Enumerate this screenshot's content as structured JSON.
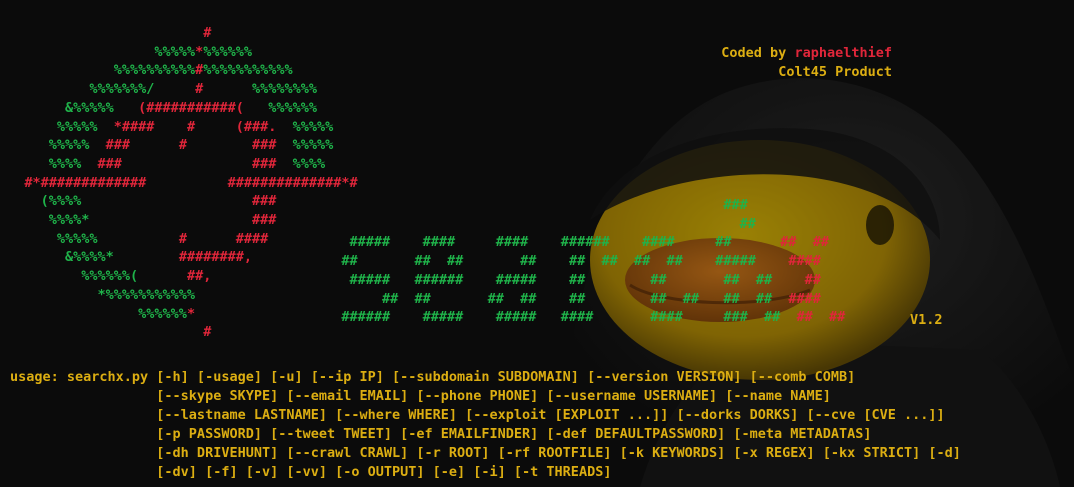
{
  "colors": {
    "background": "#0c0c0c",
    "green": "#1fb34a",
    "red": "#e0263a",
    "yellow": "#dcae12"
  },
  "credits": {
    "coded_by_label": "Coded by",
    "author": "raphaelthief",
    "product": "Colt45 Product"
  },
  "version": "V1.2",
  "logo_art": {
    "left_lines": [
      [
        [
          "r",
          "                         #"
        ]
      ],
      [
        [
          "g",
          "                   %%%%%"
        ],
        [
          "r",
          "*"
        ],
        [
          "g",
          "%%%%%%"
        ]
      ],
      [
        [
          "g",
          "              %%%%%%%%%%"
        ],
        [
          "r",
          "#"
        ],
        [
          "g",
          "%%%%%%%%%%%"
        ]
      ],
      [
        [
          "g",
          "           %%%%%%%/"
        ],
        [
          "r",
          "     #      "
        ],
        [
          "g",
          "%%%%%%%%"
        ]
      ],
      [
        [
          "g",
          "        &%%%%%   "
        ],
        [
          "r",
          "(###########(   "
        ],
        [
          "g",
          "%%%%%%"
        ]
      ],
      [
        [
          "g",
          "       %%%%%  "
        ],
        [
          "r",
          "*####    #     (###.  "
        ],
        [
          "g",
          "%%%%%"
        ]
      ],
      [
        [
          "g",
          "      %%%%%  "
        ],
        [
          "r",
          "###      #        ###  "
        ],
        [
          "g",
          "%%%%%"
        ]
      ],
      [
        [
          "g",
          "      %%%%  "
        ],
        [
          "r",
          "###                ###  "
        ],
        [
          "g",
          "%%%%"
        ]
      ],
      [
        [
          "r",
          "   #*#############          ##############*#"
        ]
      ],
      [
        [
          "g",
          "     (%%%%"
        ],
        [
          "r",
          "                     ###"
        ]
      ],
      [
        [
          "g",
          "      %%%%*"
        ],
        [
          "r",
          "                    ###"
        ]
      ],
      [
        [
          "g",
          "       %%%%%"
        ],
        [
          "r",
          "          #      ####"
        ]
      ],
      [
        [
          "g",
          "        &%%%%*"
        ],
        [
          "r",
          "        ########,"
        ]
      ],
      [
        [
          "g",
          "          %%%%%%("
        ],
        [
          "r",
          "      ##,"
        ]
      ],
      [
        [
          "g",
          "            *%%%%%%%%%%%"
        ]
      ],
      [
        [
          "g",
          "                 %%%%%%"
        ],
        [
          "r",
          "*"
        ]
      ],
      [
        [
          "r",
          "                         #"
        ]
      ]
    ],
    "title_lines": [
      [
        [
          "g",
          "                                                                                         ###"
        ]
      ],
      [
        [
          "g",
          "                                                                                           ##"
        ]
      ],
      [
        [
          "g",
          "                                           #####    ####     ####    ######    ####     ##      "
        ],
        [
          "r",
          "##  ##"
        ]
      ],
      [
        [
          "g",
          "                                          ##       ##  ##       ##    ##  ##  ##  ##    #####    "
        ],
        [
          "r",
          "####"
        ]
      ],
      [
        [
          "g",
          "                                           #####   ######    #####    ##        ##       ##  ##    "
        ],
        [
          "r",
          "##"
        ]
      ],
      [
        [
          "g",
          "                                               ##  ##       ##  ##    ##        ##  ##   ##  ##  "
        ],
        [
          "r",
          "####"
        ]
      ],
      [
        [
          "g",
          "                                          ######    #####    #####   ####       ####     ###  ##  "
        ],
        [
          "r",
          "##  ##"
        ]
      ]
    ]
  },
  "usage_lines": [
    "usage: searchx.py [-h] [-usage] [-u] [--ip IP] [--subdomain SUBDOMAIN] [--version VERSION] [--comb COMB]",
    "                  [--skype SKYPE] [--email EMAIL] [--phone PHONE] [--username USERNAME] [--name NAME]",
    "                  [--lastname LASTNAME] [--where WHERE] [--exploit [EXPLOIT ...]] [--dorks DORKS] [--cve [CVE ...]]",
    "                  [-p PASSWORD] [--tweet TWEET] [-ef EMAILFINDER] [-def DEFAULTPASSWORD] [-meta METADATAS]",
    "                  [-dh DRIVEHUNT] [--crawl CRAWL] [-r ROOT] [-rf ROOTFILE] [-k KEYWORDS] [-x REGEX] [-kx STRICT] [-d]",
    "                  [-dv] [-f] [-v] [-vv] [-o OUTPUT] [-e] [-i] [-t THREADS]"
  ]
}
